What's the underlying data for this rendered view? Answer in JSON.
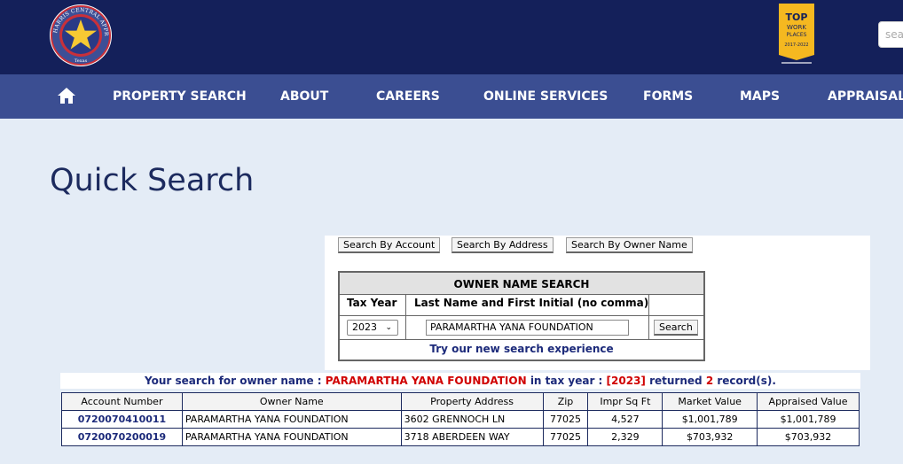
{
  "header": {
    "seal_text": "HARRIS CENTRAL APPRAISAL DISTRICT",
    "seal_sub": "Texas",
    "badge_lines": [
      "TOP",
      "WORK",
      "PLACES",
      "2017-2022"
    ],
    "search_placeholder": "sea"
  },
  "nav": {
    "items": [
      "PROPERTY SEARCH",
      "ABOUT",
      "CAREERS",
      "ONLINE SERVICES",
      "FORMS",
      "MAPS",
      "APPRAISAL"
    ]
  },
  "page_title": "Quick Search",
  "search_tabs": {
    "by_account": "Search By Account",
    "by_address": "Search By Address",
    "by_owner": "Search By Owner Name"
  },
  "owner_search": {
    "title": "OWNER NAME SEARCH",
    "col_tax_year": "Tax Year",
    "col_name": "Last Name and First Initial (no comma)",
    "tax_year_value": "2023",
    "name_value": "PARAMARTHA YANA FOUNDATION",
    "search_button": "Search",
    "new_experience_link": "Try our new search experience"
  },
  "summary": {
    "prefix": "Your search for owner name : ",
    "owner": "PARAMARTHA YANA FOUNDATION",
    "mid": " in tax year : ",
    "year": "[2023]",
    "returned": " returned ",
    "count": "2",
    "suffix": " record(s)."
  },
  "results": {
    "columns": [
      "Account Number",
      "Owner Name",
      "Property Address",
      "Zip",
      "Impr Sq Ft",
      "Market Value",
      "Appraised Value"
    ],
    "rows": [
      [
        "0720070410011",
        "PARAMARTHA YANA FOUNDATION",
        "3602 GRENNOCH LN",
        "77025",
        "4,527",
        "$1,001,789",
        "$1,001,789"
      ],
      [
        "0720070200019",
        "PARAMARTHA YANA FOUNDATION",
        "3718 ABERDEEN WAY",
        "77025",
        "2,329",
        "$703,932",
        "$703,932"
      ]
    ]
  },
  "colors": {
    "header_bg": "#14205a",
    "nav_bg": "#3b4e92",
    "page_bg": "#e4ecf6",
    "link_blue": "#1c2a7a",
    "highlight_red": "#d00000",
    "badge_gold": "#f5b820"
  },
  "icons": {
    "home": "home-icon",
    "star": "star-icon",
    "chevron": "chevron-down-icon"
  }
}
